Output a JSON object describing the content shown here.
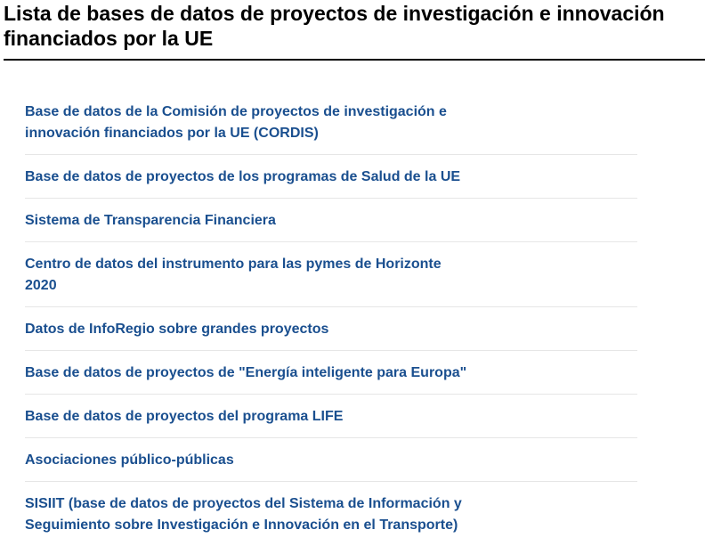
{
  "page": {
    "title": "Lista de bases de datos de proyectos de investigación e innovación financiados por la UE"
  },
  "links": [
    {
      "label": "Base de datos de la Comisión de proyectos de investigación e innovación financiados por la UE (CORDIS)"
    },
    {
      "label": "Base de datos de proyectos de los programas de Salud de la UE"
    },
    {
      "label": "Sistema de Transparencia Financiera"
    },
    {
      "label": "Centro de datos del instrumento para las pymes de Horizonte 2020"
    },
    {
      "label": "Datos de InfoRegio sobre grandes proyectos"
    },
    {
      "label": "Base de datos de proyectos de \"Energía inteligente para Europa\""
    },
    {
      "label": "Base de datos de proyectos del programa LIFE"
    },
    {
      "label": "Asociaciones público-públicas"
    },
    {
      "label": "SISIIT (base de datos de proyectos del Sistema de Información y Seguimiento sobre Investigación e Innovación en el Transporte)"
    }
  ],
  "colors": {
    "link": "#1a4f8f",
    "title": "#000000",
    "divider": "#e6e6e6"
  }
}
